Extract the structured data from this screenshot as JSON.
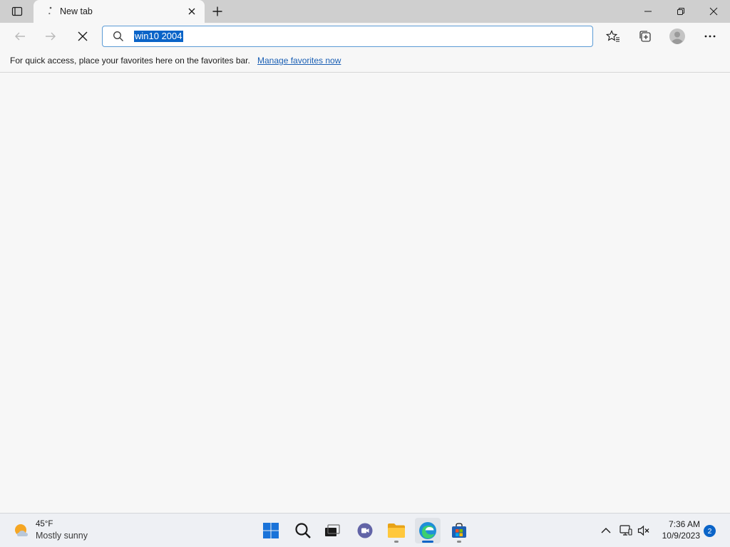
{
  "browser": {
    "tab": {
      "title": "New tab"
    },
    "address_bar": {
      "value": "win10 2004"
    },
    "favorites_bar": {
      "message": "For quick access, place your favorites here on the favorites bar.",
      "link": "Manage favorites now"
    }
  },
  "taskbar": {
    "weather": {
      "temperature": "45°F",
      "condition": "Mostly sunny"
    },
    "apps": [
      "start",
      "search",
      "task-view",
      "chat",
      "file-explorer",
      "edge",
      "microsoft-store"
    ],
    "clock": {
      "time": "7:36 AM",
      "date": "10/9/2023"
    },
    "notifications": {
      "count": "2"
    }
  },
  "colors": {
    "accent": "#0a64c8",
    "selection": "#0a64c8",
    "link": "#1a5fb4",
    "titlebar": "#cfcfcf",
    "page_background": "#f7f7f7"
  }
}
